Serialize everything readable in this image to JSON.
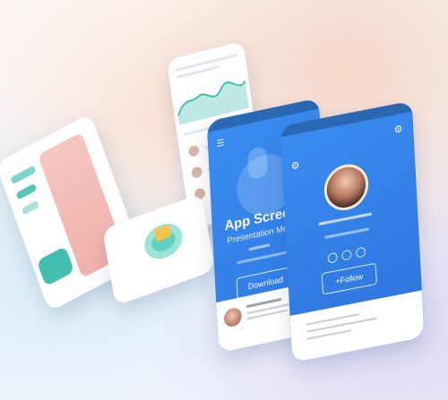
{
  "main_screen": {
    "title": "App Screens",
    "subtitle": "Presentation Mockup",
    "button_label": "Download"
  },
  "profile_screen": {
    "button_label": "+Follow"
  },
  "colors": {
    "primary_blue": "#3a8df0",
    "teal": "#42bfb0",
    "pink": "#f2b1ab"
  },
  "icons": [
    "menu-icon",
    "gear-icon",
    "share-icon"
  ]
}
